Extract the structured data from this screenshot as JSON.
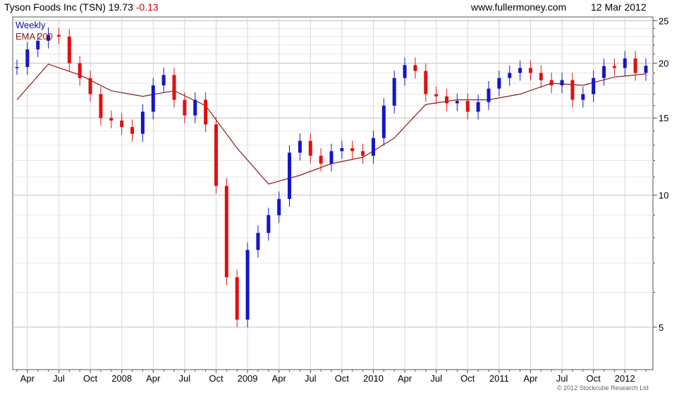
{
  "header": {
    "company": "Tyson Foods Inc (TSN)",
    "price": "19.73",
    "change": "-0.13",
    "website": "www.fullermoney.com",
    "date": "12 Mar 2012"
  },
  "legend": {
    "series1": "Weekly",
    "series2": "EMA 200"
  },
  "copyright": "© 2012 Stockcube Research Ltd",
  "colors": {
    "up": "#1515c8",
    "down": "#e01010",
    "ema": "#8b1a1a",
    "grid": "#dcdcdc"
  },
  "chart_data": {
    "type": "line",
    "title": "Tyson Foods Inc (TSN)",
    "ylim": [
      4,
      25.5
    ],
    "y_scale": "log",
    "x_ticks": [
      "Apr",
      "Jul",
      "Oct",
      "2008",
      "Apr",
      "Jul",
      "Oct",
      "2009",
      "Apr",
      "Jul",
      "Oct",
      "2010",
      "Apr",
      "Jul",
      "Oct",
      "2011",
      "Apr",
      "Jul",
      "Oct",
      "2012"
    ],
    "y_ticks": [
      5,
      10,
      15,
      20,
      25
    ],
    "grid": true,
    "legend_position": "top-left",
    "series": [
      {
        "name": "Weekly",
        "style": "candlestick",
        "x": [
          "2007-03",
          "2007-04",
          "2007-05",
          "2007-06",
          "2007-07",
          "2007-08",
          "2007-09",
          "2007-10",
          "2007-11",
          "2007-12",
          "2008-01",
          "2008-02",
          "2008-03",
          "2008-04",
          "2008-05",
          "2008-06",
          "2008-07",
          "2008-08",
          "2008-09",
          "2008-10",
          "2008-11",
          "2008-12",
          "2009-01",
          "2009-02",
          "2009-03",
          "2009-04",
          "2009-05",
          "2009-06",
          "2009-07",
          "2009-08",
          "2009-09",
          "2009-10",
          "2009-11",
          "2009-12",
          "2010-01",
          "2010-02",
          "2010-03",
          "2010-04",
          "2010-05",
          "2010-06",
          "2010-07",
          "2010-08",
          "2010-09",
          "2010-10",
          "2010-11",
          "2010-12",
          "2011-01",
          "2011-02",
          "2011-03",
          "2011-04",
          "2011-05",
          "2011-06",
          "2011-07",
          "2011-08",
          "2011-09",
          "2011-10",
          "2011-11",
          "2011-12",
          "2012-01",
          "2012-02",
          "2012-03"
        ],
        "values": [
          19.6,
          21.5,
          22.5,
          23.2,
          23.0,
          20.0,
          18.5,
          17.0,
          15.0,
          14.8,
          14.3,
          13.8,
          15.5,
          17.8,
          18.8,
          16.5,
          15.2,
          16.5,
          14.5,
          10.5,
          6.5,
          5.2,
          7.5,
          8.2,
          9.0,
          9.8,
          12.5,
          13.3,
          12.3,
          11.8,
          12.6,
          12.8,
          12.6,
          12.3,
          13.5,
          16.0,
          18.5,
          19.8,
          19.2,
          17.0,
          16.8,
          16.2,
          16.4,
          15.5,
          16.3,
          17.5,
          18.5,
          19.0,
          19.5,
          19.0,
          18.3,
          17.8,
          18.3,
          16.5,
          17.0,
          18.5,
          19.7,
          19.5,
          20.5,
          19.0,
          19.73
        ]
      },
      {
        "name": "EMA 200",
        "style": "line",
        "x": [
          "2007-03",
          "2007-06",
          "2007-09",
          "2007-12",
          "2008-03",
          "2008-06",
          "2008-09",
          "2008-12",
          "2009-03",
          "2009-06",
          "2009-09",
          "2009-12",
          "2010-03",
          "2010-06",
          "2010-09",
          "2010-12",
          "2011-03",
          "2011-06",
          "2011-09",
          "2011-12",
          "2012-03"
        ],
        "values": [
          16.5,
          19.9,
          18.8,
          17.3,
          16.8,
          17.3,
          16.0,
          12.8,
          10.6,
          11.1,
          11.8,
          12.2,
          13.5,
          16.1,
          16.5,
          16.5,
          17.0,
          18.0,
          17.8,
          18.6,
          18.9
        ]
      }
    ]
  }
}
